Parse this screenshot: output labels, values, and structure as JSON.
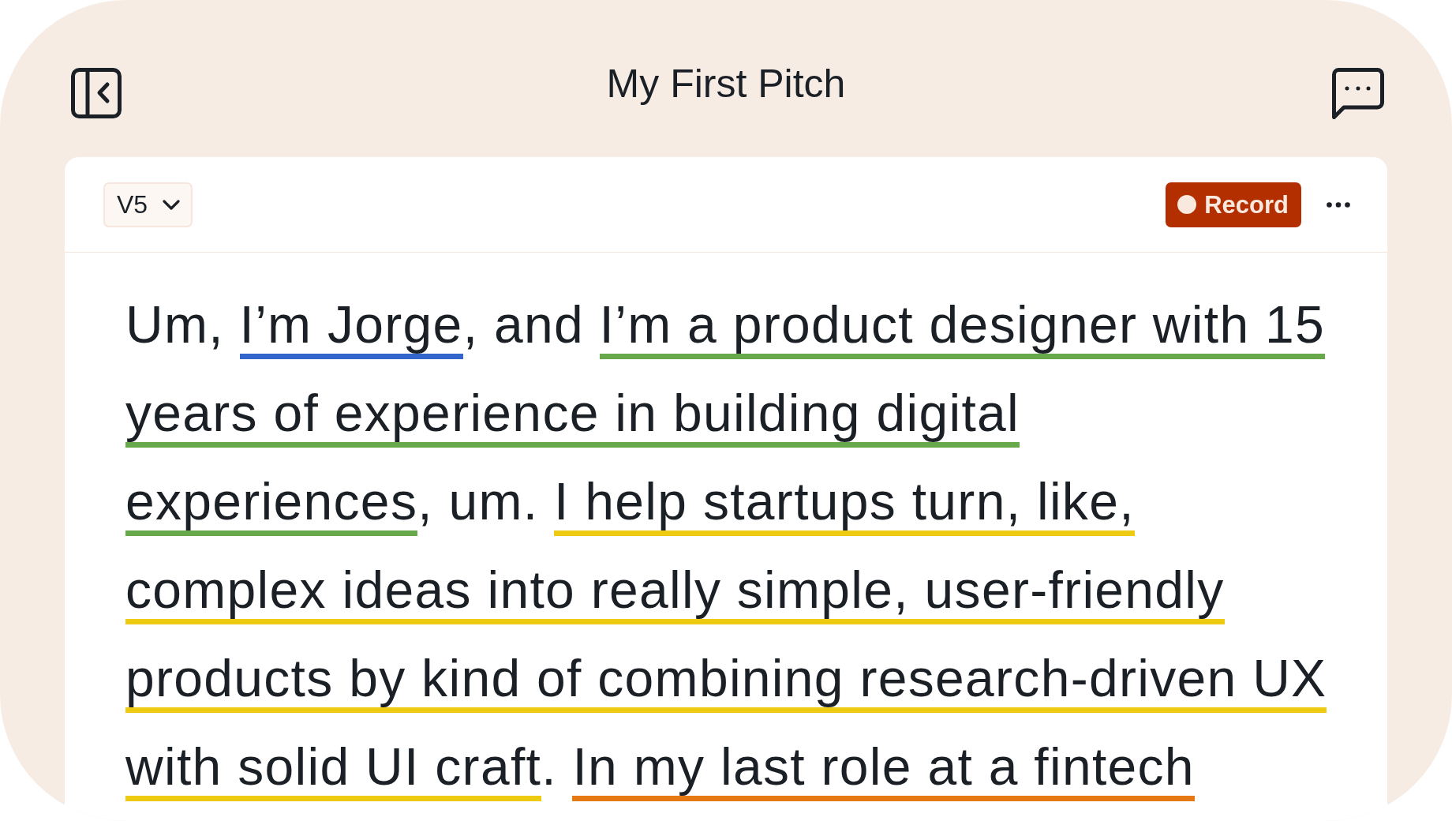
{
  "header": {
    "title": "My First Pitch"
  },
  "toolbar": {
    "version": "V5",
    "record_button": "Record"
  },
  "transcript": {
    "segments": [
      {
        "text": "Um, "
      },
      {
        "text": "I’m Jorge",
        "color": "#3366cc"
      },
      {
        "text": ", and "
      },
      {
        "text": "I’m a product designer with 15 years of experience in building digital experiences",
        "color": "#66a84a"
      },
      {
        "text": ", um. "
      },
      {
        "text": "I help startups turn, like, complex ideas into really simple, user-friendly products by kind of combining research-driven UX with solid UI craft",
        "color": "#eccb12"
      },
      {
        "text": ". "
      },
      {
        "text": "In my last role at a fintech",
        "color": "#e77914"
      }
    ]
  }
}
